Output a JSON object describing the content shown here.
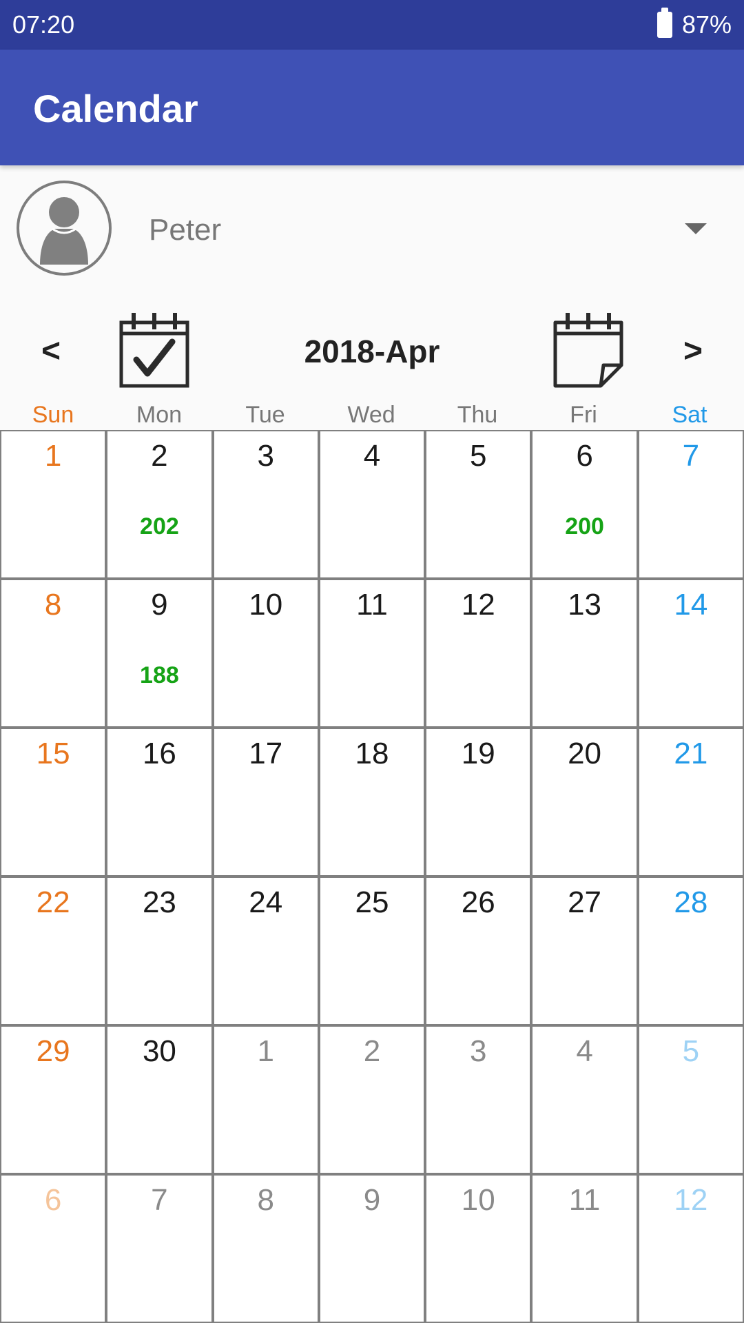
{
  "status_bar": {
    "time": "07:20",
    "battery_percent": "87%",
    "battery_icon": "battery-icon"
  },
  "app_bar": {
    "title": "Calendar"
  },
  "user": {
    "name": "Peter",
    "avatar_icon": "person-icon",
    "dropdown_icon": "dropdown-arrow-icon"
  },
  "month_nav": {
    "prev_label": "<",
    "next_label": ">",
    "title": "2018-Apr",
    "today_icon": "calendar-check-icon",
    "page_icon": "calendar-page-icon"
  },
  "weekdays": [
    "Sun",
    "Mon",
    "Tue",
    "Wed",
    "Thu",
    "Fri",
    "Sat"
  ],
  "colors": {
    "status_bar": "#2e3d99",
    "app_bar": "#3f51b5",
    "sunday": "#e8761e",
    "saturday": "#2199e8",
    "value_green": "#16a316",
    "grid_line": "#808080"
  },
  "weeks": [
    [
      {
        "day": "1",
        "value": ""
      },
      {
        "day": "2",
        "value": "202"
      },
      {
        "day": "3",
        "value": ""
      },
      {
        "day": "4",
        "value": ""
      },
      {
        "day": "5",
        "value": ""
      },
      {
        "day": "6",
        "value": "200"
      },
      {
        "day": "7",
        "value": ""
      }
    ],
    [
      {
        "day": "8",
        "value": ""
      },
      {
        "day": "9",
        "value": "188"
      },
      {
        "day": "10",
        "value": ""
      },
      {
        "day": "11",
        "value": ""
      },
      {
        "day": "12",
        "value": ""
      },
      {
        "day": "13",
        "value": ""
      },
      {
        "day": "14",
        "value": ""
      }
    ],
    [
      {
        "day": "15",
        "value": ""
      },
      {
        "day": "16",
        "value": ""
      },
      {
        "day": "17",
        "value": ""
      },
      {
        "day": "18",
        "value": ""
      },
      {
        "day": "19",
        "value": ""
      },
      {
        "day": "20",
        "value": ""
      },
      {
        "day": "21",
        "value": ""
      }
    ],
    [
      {
        "day": "22",
        "value": ""
      },
      {
        "day": "23",
        "value": ""
      },
      {
        "day": "24",
        "value": ""
      },
      {
        "day": "25",
        "value": ""
      },
      {
        "day": "26",
        "value": ""
      },
      {
        "day": "27",
        "value": ""
      },
      {
        "day": "28",
        "value": ""
      }
    ],
    [
      {
        "day": "29",
        "value": ""
      },
      {
        "day": "30",
        "value": ""
      },
      {
        "day": "1",
        "value": ""
      },
      {
        "day": "2",
        "value": ""
      },
      {
        "day": "3",
        "value": ""
      },
      {
        "day": "4",
        "value": ""
      },
      {
        "day": "5",
        "value": ""
      }
    ],
    [
      {
        "day": "6",
        "value": ""
      },
      {
        "day": "7",
        "value": ""
      },
      {
        "day": "8",
        "value": ""
      },
      {
        "day": "9",
        "value": ""
      },
      {
        "day": "10",
        "value": ""
      },
      {
        "day": "11",
        "value": ""
      },
      {
        "day": "12",
        "value": ""
      }
    ]
  ]
}
